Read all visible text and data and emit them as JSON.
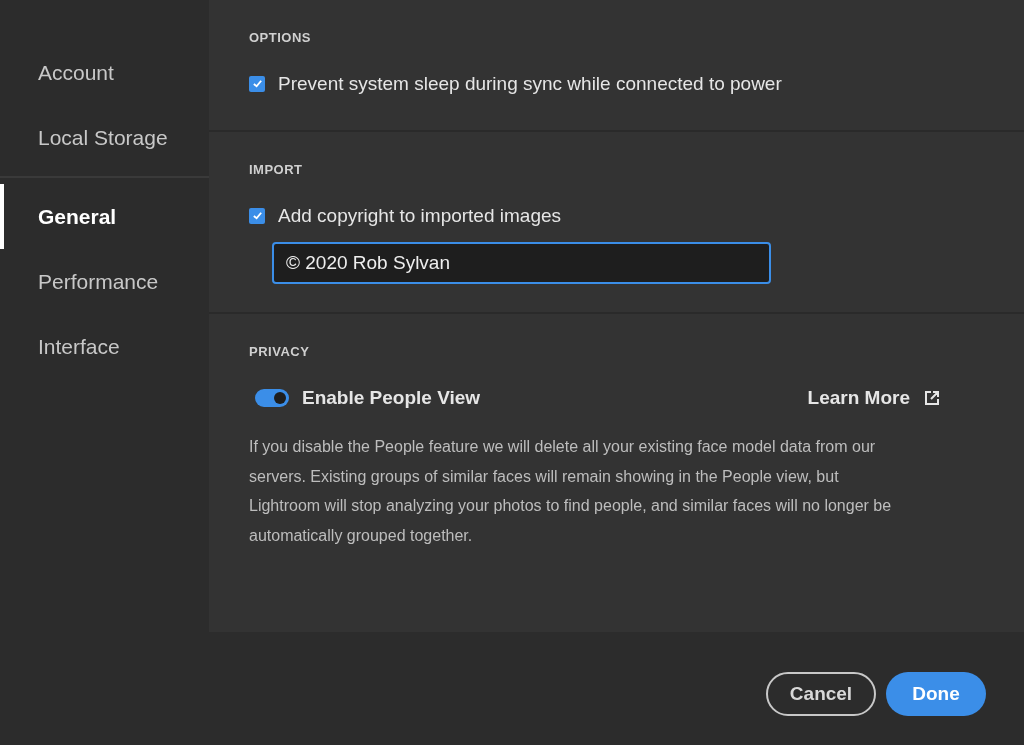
{
  "sidebar": {
    "groups": [
      [
        {
          "label": "Account",
          "selected": false
        },
        {
          "label": "Local Storage",
          "selected": false
        }
      ],
      [
        {
          "label": "General",
          "selected": true
        },
        {
          "label": "Performance",
          "selected": false
        },
        {
          "label": "Interface",
          "selected": false
        }
      ]
    ]
  },
  "sections": [
    {
      "title": "OPTIONS",
      "items": [
        {
          "kind": "checkbox",
          "label": "Prevent system sleep during sync while connected to power",
          "checked": true
        }
      ]
    },
    {
      "title": "IMPORT",
      "items": [
        {
          "kind": "checkbox",
          "label": "Add copyright to imported images",
          "checked": true
        },
        {
          "kind": "field",
          "value": "© 2020 Rob Sylvan"
        }
      ]
    },
    {
      "title": "PRIVACY",
      "items": [
        {
          "kind": "toggle",
          "label": "Enable People View",
          "on": true,
          "link": "Learn More"
        },
        {
          "kind": "text",
          "text": "If you disable the People feature we will delete all your existing face model data from our servers. Existing groups of similar faces will remain showing in the People view, but Lightroom will stop analyzing your photos to find people, and similar faces will no longer be automatically grouped together."
        }
      ]
    }
  ],
  "buttons": [
    {
      "label": "Cancel",
      "kind": "secondary"
    },
    {
      "label": "Done",
      "kind": "primary"
    }
  ]
}
